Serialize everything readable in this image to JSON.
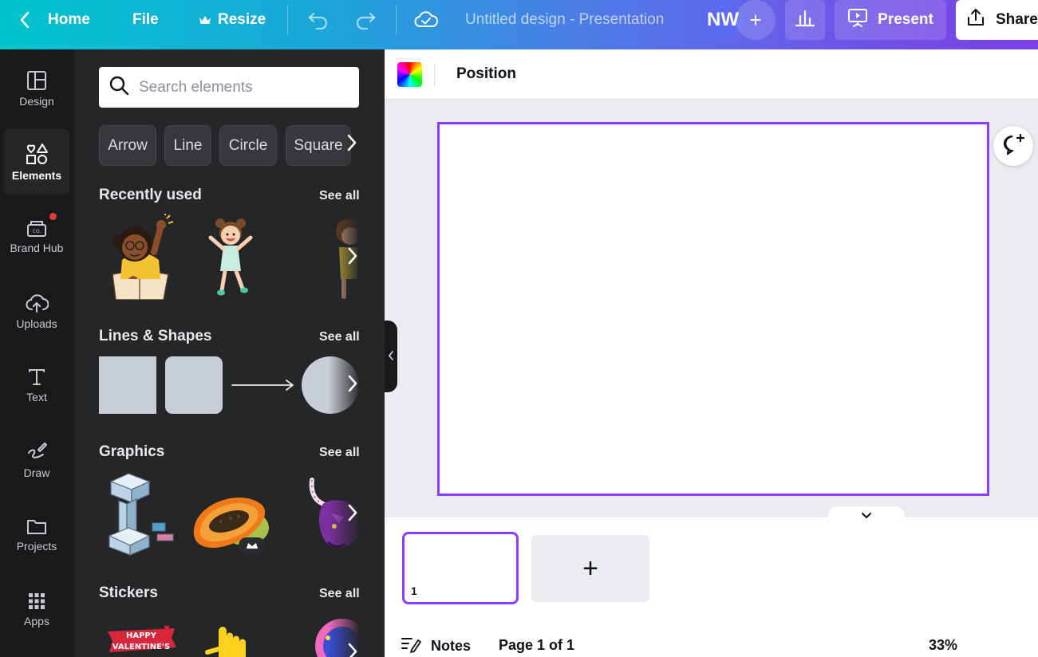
{
  "topbar": {
    "home": "Home",
    "file": "File",
    "resize": "Resize",
    "doc_title": "Untitled design - Presentation",
    "avatar_initials": "NW",
    "add_collaborator": "+",
    "present": "Present",
    "share": "Share"
  },
  "rail": {
    "items": [
      {
        "label": "Design",
        "icon": "layout-icon"
      },
      {
        "label": "Elements",
        "icon": "shapes-icon"
      },
      {
        "label": "Brand Hub",
        "icon": "brand-hub-icon"
      },
      {
        "label": "Uploads",
        "icon": "cloud-upload-icon"
      },
      {
        "label": "Text",
        "icon": "text-icon"
      },
      {
        "label": "Draw",
        "icon": "draw-icon"
      },
      {
        "label": "Projects",
        "icon": "folder-icon"
      },
      {
        "label": "Apps",
        "icon": "apps-grid-icon"
      }
    ]
  },
  "panel": {
    "search_placeholder": "Search elements",
    "chips": [
      "Arrow",
      "Line",
      "Circle",
      "Square"
    ],
    "see_all": "See all",
    "sections": {
      "recently_used": "Recently used",
      "lines_shapes": "Lines & Shapes",
      "graphics": "Graphics",
      "stickers": "Stickers"
    },
    "sticker_text": "HAPPY VALENTINE'S"
  },
  "editor": {
    "position": "Position",
    "page_number": "1",
    "add_page": "+",
    "notes": "Notes",
    "page_count": "Page 1 of 1",
    "zoom": "33%"
  },
  "colors": {
    "accent": "#8b3dff",
    "rail_bg": "#18191b",
    "panel_bg": "#252627",
    "canvas_bg": "#ebecf0"
  }
}
